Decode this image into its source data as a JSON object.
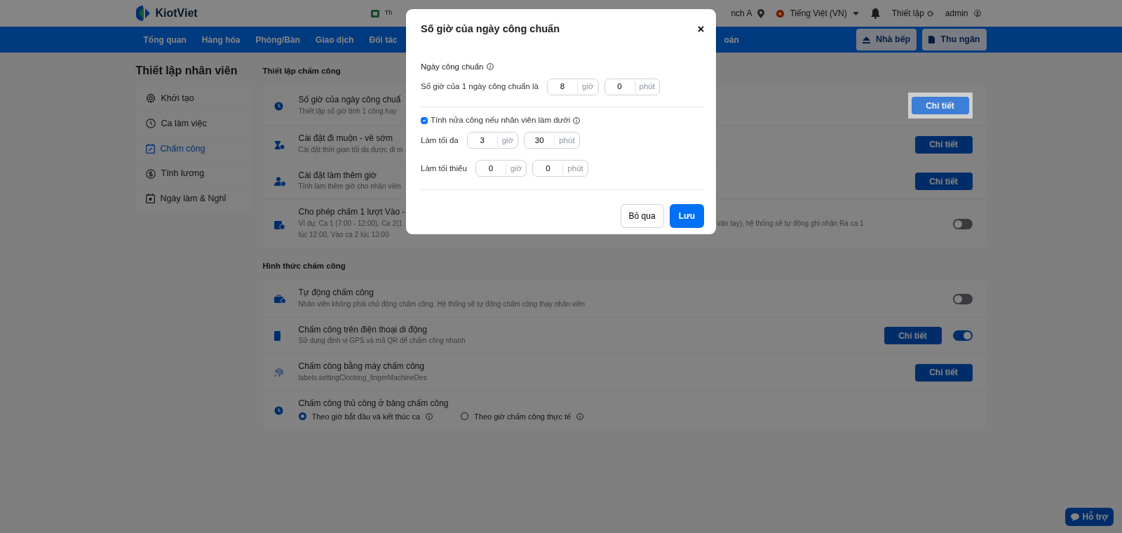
{
  "header": {
    "logo": "KiotViet",
    "partial_left": "Th",
    "partial_right": "nch A",
    "language": "Tiếng Việt (VN)",
    "settings": "Thiết lập",
    "user": "admin"
  },
  "nav": {
    "items": [
      {
        "label": "Tổng quan"
      },
      {
        "label": "Hàng hóa"
      },
      {
        "label": "Phòng/Bàn"
      },
      {
        "label": "Giao dịch"
      },
      {
        "label": "Đối tác"
      }
    ],
    "partial_item": "oán",
    "buttons": [
      {
        "label": "Nhà bếp"
      },
      {
        "label": "Thu ngân"
      }
    ]
  },
  "sidebar": {
    "title": "Thiết lập nhân viên",
    "items": [
      {
        "label": "Khởi tạo",
        "selected": false
      },
      {
        "label": "Ca làm việc",
        "selected": false
      },
      {
        "label": "Chấm công",
        "selected": true
      },
      {
        "label": "Tính lương",
        "selected": false
      },
      {
        "label": "Ngày làm & Nghỉ",
        "selected": false
      }
    ]
  },
  "sections": [
    {
      "title": "Thiết lập chấm công",
      "rows": [
        {
          "title": "Số giờ của ngày công chuẩ",
          "description": [
            {
              "text": "Thiết lập số giờ tính 1 công hay"
            }
          ],
          "actions": [
            {
              "kind": "button",
              "label": "Chi tiết",
              "highlighted": true
            }
          ]
        },
        {
          "title": "Cài đặt đi muộn - về sớm",
          "description": [
            {
              "text": "Cài đặt thời gian tối đa được đi m"
            }
          ],
          "actions": [
            {
              "kind": "button",
              "label": "Chi tiết",
              "highlighted": false
            }
          ]
        },
        {
          "title": "Cài đặt làm thêm giờ",
          "description": [
            {
              "text": "Tính làm thêm giờ cho nhân viên"
            }
          ],
          "actions": [
            {
              "kind": "button",
              "label": "Chi tiết",
              "highlighted": false
            }
          ]
        },
        {
          "title": "Cho phép chấm 1 lượt Vào -",
          "description": [
            {
              "text": "Ví dụ: Ca 1 (7:00 - 12:00), Ca 2(1",
              "visible_end": "vân tay), hệ thống sẽ tự động ghi nhận Ra ca 1"
            },
            {
              "text": "lúc 12:00, Vào ca 2 lúc 13:00"
            }
          ],
          "actions": [
            {
              "kind": "toggle",
              "on": false
            }
          ]
        }
      ]
    },
    {
      "title": "Hình thức chấm công",
      "rows": [
        {
          "title": "Tự động chấm công",
          "description": [
            {
              "text": "Nhân viên không phải chủ động chấm công. Hệ thống sẽ tự động chấm công thay nhân viên"
            }
          ],
          "actions": [
            {
              "kind": "toggle",
              "on": false
            }
          ]
        },
        {
          "title": "Chấm công trên điện thoại di động",
          "description": [
            {
              "text": "Sử dụng định vị GPS và mã QR để chấm công nhanh"
            }
          ],
          "actions": [
            {
              "kind": "button",
              "label": "Chi tiết",
              "highlighted": false
            },
            {
              "kind": "toggle",
              "on": true
            }
          ]
        },
        {
          "title": "Chấm công bằng máy chấm công",
          "description": [
            {
              "text": "labels.settingClocking_fingerMachineDes"
            }
          ],
          "actions": [
            {
              "kind": "button",
              "label": "Chi tiết",
              "highlighted": false
            }
          ]
        },
        {
          "title": "Chấm công thủ công ở bảng chấm công",
          "options": [
            {
              "label": "Theo giờ bắt đầu và kết thúc ca",
              "selected": true
            },
            {
              "label": "Theo giờ chấm công thực tế",
              "selected": false
            }
          ]
        }
      ]
    }
  ],
  "dialog": {
    "title": "Số giờ của ngày công chuẩn",
    "body": [
      {
        "kind": "heading",
        "label": "Ngày công chuẩn"
      },
      {
        "kind": "time",
        "label": "Số giờ của 1 ngày công chuẩn là",
        "hours": "8",
        "hour_unit": "giờ",
        "minutes": "0",
        "minute_unit": "phút"
      },
      {
        "kind": "divider"
      },
      {
        "kind": "checkbox",
        "label": "Tính nửa công nếu nhân viên làm dưới",
        "checked": true
      },
      {
        "kind": "time",
        "label": "Làm tối đa",
        "hours": "3",
        "hour_unit": "giờ",
        "minutes": "30",
        "minute_unit": "phút"
      },
      {
        "kind": "time",
        "label": "Làm tối thiểu",
        "hours": "0",
        "hour_unit": "giờ",
        "minutes": "0",
        "minute_unit": "phút"
      },
      {
        "kind": "divider"
      }
    ],
    "buttons": [
      {
        "kind": "secondary",
        "label": "Bỏ qua"
      },
      {
        "kind": "primary",
        "label": "Lưu"
      }
    ]
  },
  "help_button": "Hỗ trợ"
}
